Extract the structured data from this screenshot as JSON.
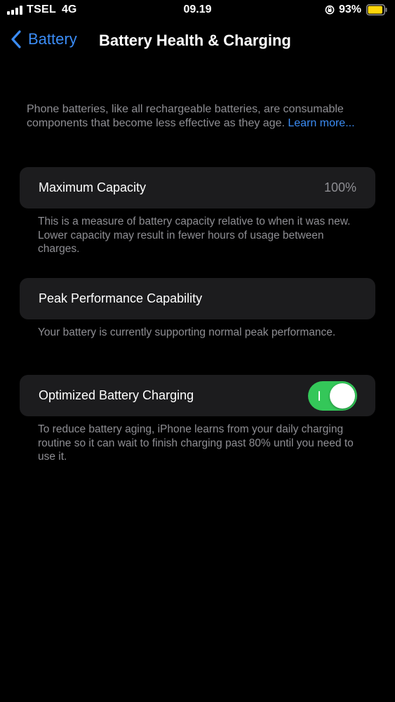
{
  "status_bar": {
    "carrier": "TSEL",
    "network": "4G",
    "time": "09.19",
    "battery_percent": "93%",
    "battery_level": 0.93,
    "battery_color": "#ffd60a",
    "icons": [
      "cellular-signal-icon",
      "rotation-lock-icon",
      "battery-icon"
    ]
  },
  "nav": {
    "back_label": "Battery",
    "title": "Battery Health & Charging",
    "accent_color": "#3b8cf5"
  },
  "intro": {
    "text": "Phone batteries, like all rechargeable batteries, are consumable components that become less effective as they age.",
    "link_label": "Learn more..."
  },
  "maximum_capacity": {
    "label": "Maximum Capacity",
    "value": "100%",
    "footnote": "This is a measure of battery capacity relative to when it was new. Lower capacity may result in fewer hours of usage between charges."
  },
  "peak_performance": {
    "label": "Peak Performance Capability",
    "footnote": "Your battery is currently supporting normal peak performance."
  },
  "optimized_charging": {
    "label": "Optimized Battery Charging",
    "enabled": true,
    "toggle_color": "#34c759",
    "footnote": "To reduce battery aging, iPhone learns from your daily charging routine so it can wait to finish charging past 80% until you need to use it."
  }
}
